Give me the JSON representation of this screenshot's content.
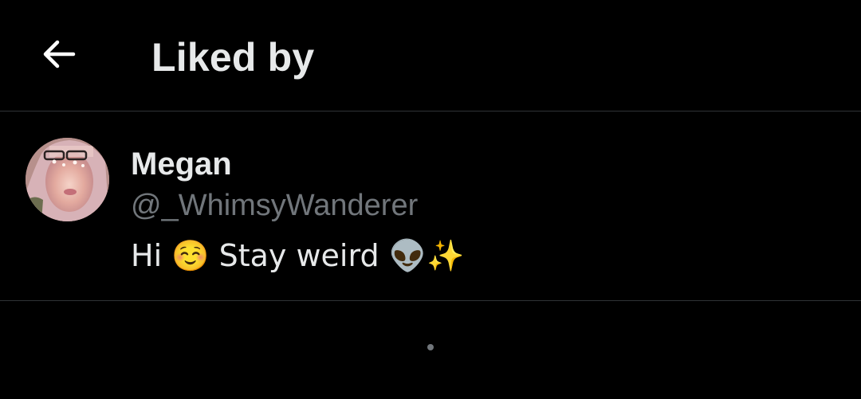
{
  "header": {
    "back_icon": "arrow-left-icon",
    "title": "Liked by"
  },
  "users": [
    {
      "name": "Megan",
      "handle": "@_WhimsyWanderer",
      "bio": "Hi ☺️ Stay weird 👽✨",
      "avatar": "profile-photo"
    }
  ],
  "colors": {
    "background": "#000000",
    "primary_text": "#e7e9ea",
    "secondary_text": "#71767b",
    "divider": "#2f3336"
  }
}
